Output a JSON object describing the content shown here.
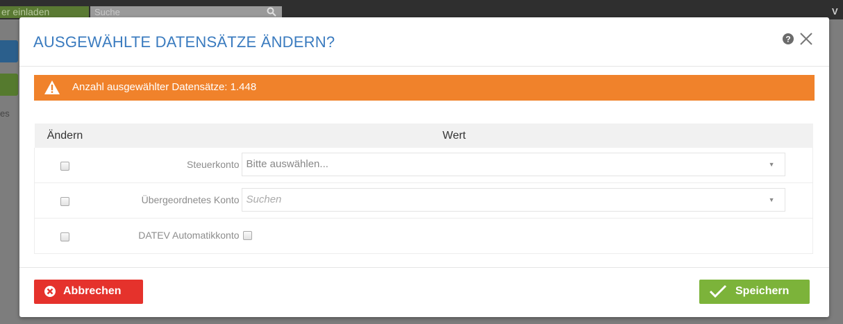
{
  "background": {
    "invite_text": "er einladen",
    "search_placeholder": "Suche",
    "right_letter": "V",
    "left_text": "es"
  },
  "modal": {
    "title": "AUSGEWÄHLTE DATENSÄTZE ÄNDERN?",
    "alert": {
      "text": "Anzahl ausgewählter Datensätze: 1.448",
      "color": "#f0822b"
    },
    "table": {
      "col_change": "Ändern",
      "col_value": "Wert",
      "rows": [
        {
          "label": "Steuerkonto",
          "type": "select",
          "value": "Bitte auswählen...",
          "checked": false
        },
        {
          "label": "Übergeordnetes Konto",
          "type": "search",
          "placeholder": "Suchen",
          "checked": false
        },
        {
          "label": "DATEV Automatikkonto",
          "type": "checkbox",
          "checked": false
        }
      ]
    },
    "footer": {
      "cancel_label": "Abbrechen",
      "save_label": "Speichern",
      "cancel_color": "#e5322c",
      "save_color": "#7cb33a"
    }
  },
  "icons": [
    "help-icon",
    "close-icon",
    "warning-icon",
    "cancel-circle-icon",
    "checkmark-icon",
    "search-icon",
    "caret-down-icon"
  ]
}
